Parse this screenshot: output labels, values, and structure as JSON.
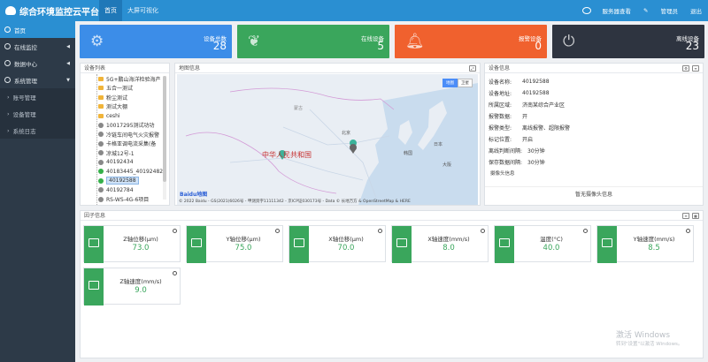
{
  "header": {
    "title": "综合环境监控云平台",
    "tabs": [
      {
        "label": "首页",
        "active": true
      },
      {
        "label": "大屏可视化",
        "active": false
      }
    ],
    "right": [
      "服务器查看",
      "管理员",
      "退出"
    ]
  },
  "sidebar": {
    "items": [
      {
        "label": "首页",
        "active": true,
        "sub": false
      },
      {
        "label": "在线监控",
        "active": false,
        "sub": false,
        "caret": "◀"
      },
      {
        "label": "数据中心",
        "active": false,
        "sub": false,
        "caret": "◀"
      },
      {
        "label": "系统管理",
        "active": false,
        "sub": false,
        "caret": "▼"
      },
      {
        "label": "账号管理",
        "active": false,
        "sub": true
      },
      {
        "label": "设备管理",
        "active": false,
        "sub": true
      },
      {
        "label": "系统日志",
        "active": false,
        "sub": true
      }
    ]
  },
  "cards": [
    {
      "label": "设备总数",
      "value": "28",
      "color": "#3c8de8",
      "icon": "gears-icon"
    },
    {
      "label": "在线设备",
      "value": "5",
      "color": "#3aa65c",
      "icon": "leaf-icon"
    },
    {
      "label": "报警设备",
      "value": "0",
      "color": "#f0612e",
      "icon": "bell-icon"
    },
    {
      "label": "离线设备",
      "value": "23",
      "color": "#2e3440",
      "icon": "plug-icon"
    }
  ],
  "device_list": {
    "title": "设备列表",
    "items": [
      {
        "label": "5G+鹏山海洋检验海产",
        "kind": "folder"
      },
      {
        "label": "五合一测试",
        "kind": "folder"
      },
      {
        "label": "粉尘测试",
        "kind": "folder"
      },
      {
        "label": "测试大棚",
        "kind": "folder"
      },
      {
        "label": "ceshi",
        "kind": "folder"
      },
      {
        "label": "10017295测试功功",
        "kind": "offline"
      },
      {
        "label": "冷链车间电气火灾报警",
        "kind": "offline"
      },
      {
        "label": "卡格亚调电流采集(备",
        "kind": "offline"
      },
      {
        "label": "凉城12号-1",
        "kind": "offline"
      },
      {
        "label": "40192434",
        "kind": "offline"
      },
      {
        "label": "40183445_40192482",
        "kind": "online"
      },
      {
        "label": "40192588",
        "kind": "online",
        "selected": true
      },
      {
        "label": "40192784",
        "kind": "offline"
      },
      {
        "label": "RS-WS-4G-6项目",
        "kind": "offline"
      }
    ]
  },
  "map": {
    "title": "地图信息",
    "toggle": [
      "地图",
      "卫星"
    ],
    "country_label": "中华人民共和国",
    "places": [
      "蒙古",
      "北京",
      "韩国",
      "日本",
      "大阪"
    ],
    "logo": "Baidu地图",
    "copyright": "© 2022 Baidu - GS(2021)6026号 - 甲测资字11111342 - 京ICP证030173号 - Data © 长地万方 & OpenStreetMap & HERE"
  },
  "device_info": {
    "title": "设备信息",
    "rows": [
      {
        "k": "设备名称:",
        "v": "40192588"
      },
      {
        "k": "设备地址:",
        "v": "40192588"
      },
      {
        "k": "所属区域:",
        "v": "济南某综合产业区"
      },
      {
        "k": "报警数据:",
        "v": "开"
      },
      {
        "k": "报警类型:",
        "v": "离线报警、超限报警"
      },
      {
        "k": "标记位置:",
        "v": "开启"
      },
      {
        "k": "离线判断间隔:",
        "v": "30分钟"
      },
      {
        "k": "保存数据间隔:",
        "v": "30分钟"
      }
    ],
    "camera_label": "摄像头信息",
    "camera_empty": "暂无摄像头信息"
  },
  "factors": {
    "title": "因子信息",
    "items": [
      {
        "name": "Z轴位移(μm)",
        "value": "73.0"
      },
      {
        "name": "Y轴位移(μm)",
        "value": "75.0"
      },
      {
        "name": "X轴位移(μm)",
        "value": "70.0"
      },
      {
        "name": "X轴速度(mm/s)",
        "value": "8.0"
      },
      {
        "name": "温度(°C)",
        "value": "40.0"
      },
      {
        "name": "Y轴速度(mm/s)",
        "value": "8.5"
      },
      {
        "name": "Z轴速度(mm/s)",
        "value": "9.0"
      }
    ]
  },
  "watermark": {
    "line1": "激活 Windows",
    "line2": "转到\"设置\"以激活 Windows。"
  }
}
